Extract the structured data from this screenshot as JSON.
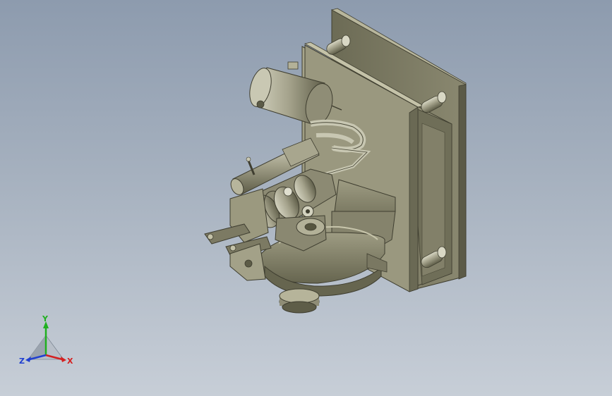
{
  "triad": {
    "x_label": "X",
    "y_label": "Y",
    "z_label": "Z"
  },
  "colors": {
    "background_top": "#8d9bae",
    "background_bottom": "#c7ced7",
    "part_base": "#8e8c76",
    "part_dark": "#56553f",
    "part_light": "#b9b79c",
    "axis_x": "#d42020",
    "axis_y": "#20b020",
    "axis_z": "#2040d0"
  }
}
